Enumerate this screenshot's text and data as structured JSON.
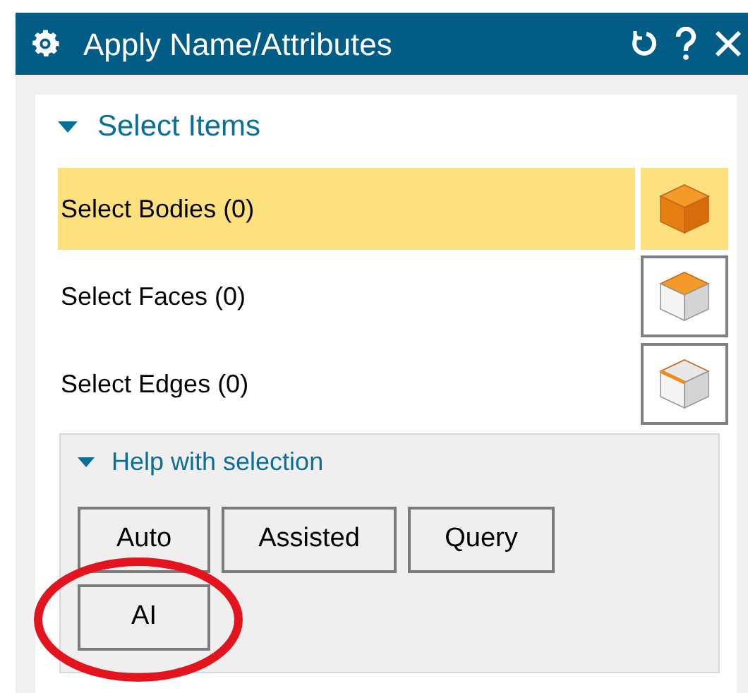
{
  "window": {
    "title": "Apply Name/Attributes"
  },
  "section": {
    "title": "Select Items",
    "expanded": true
  },
  "rows": [
    {
      "label": "Select Bodies (0)",
      "kind": "body",
      "selected": true
    },
    {
      "label": "Select Faces (0)",
      "kind": "face",
      "selected": false
    },
    {
      "label": "Select Edges (0)",
      "kind": "edge",
      "selected": false
    }
  ],
  "help": {
    "title": "Help with selection",
    "expanded": true,
    "buttons": [
      {
        "label": "Auto",
        "circled": false
      },
      {
        "label": "Assisted",
        "circled": false
      },
      {
        "label": "Query",
        "circled": false
      },
      {
        "label": "AI",
        "circled": true
      }
    ]
  }
}
